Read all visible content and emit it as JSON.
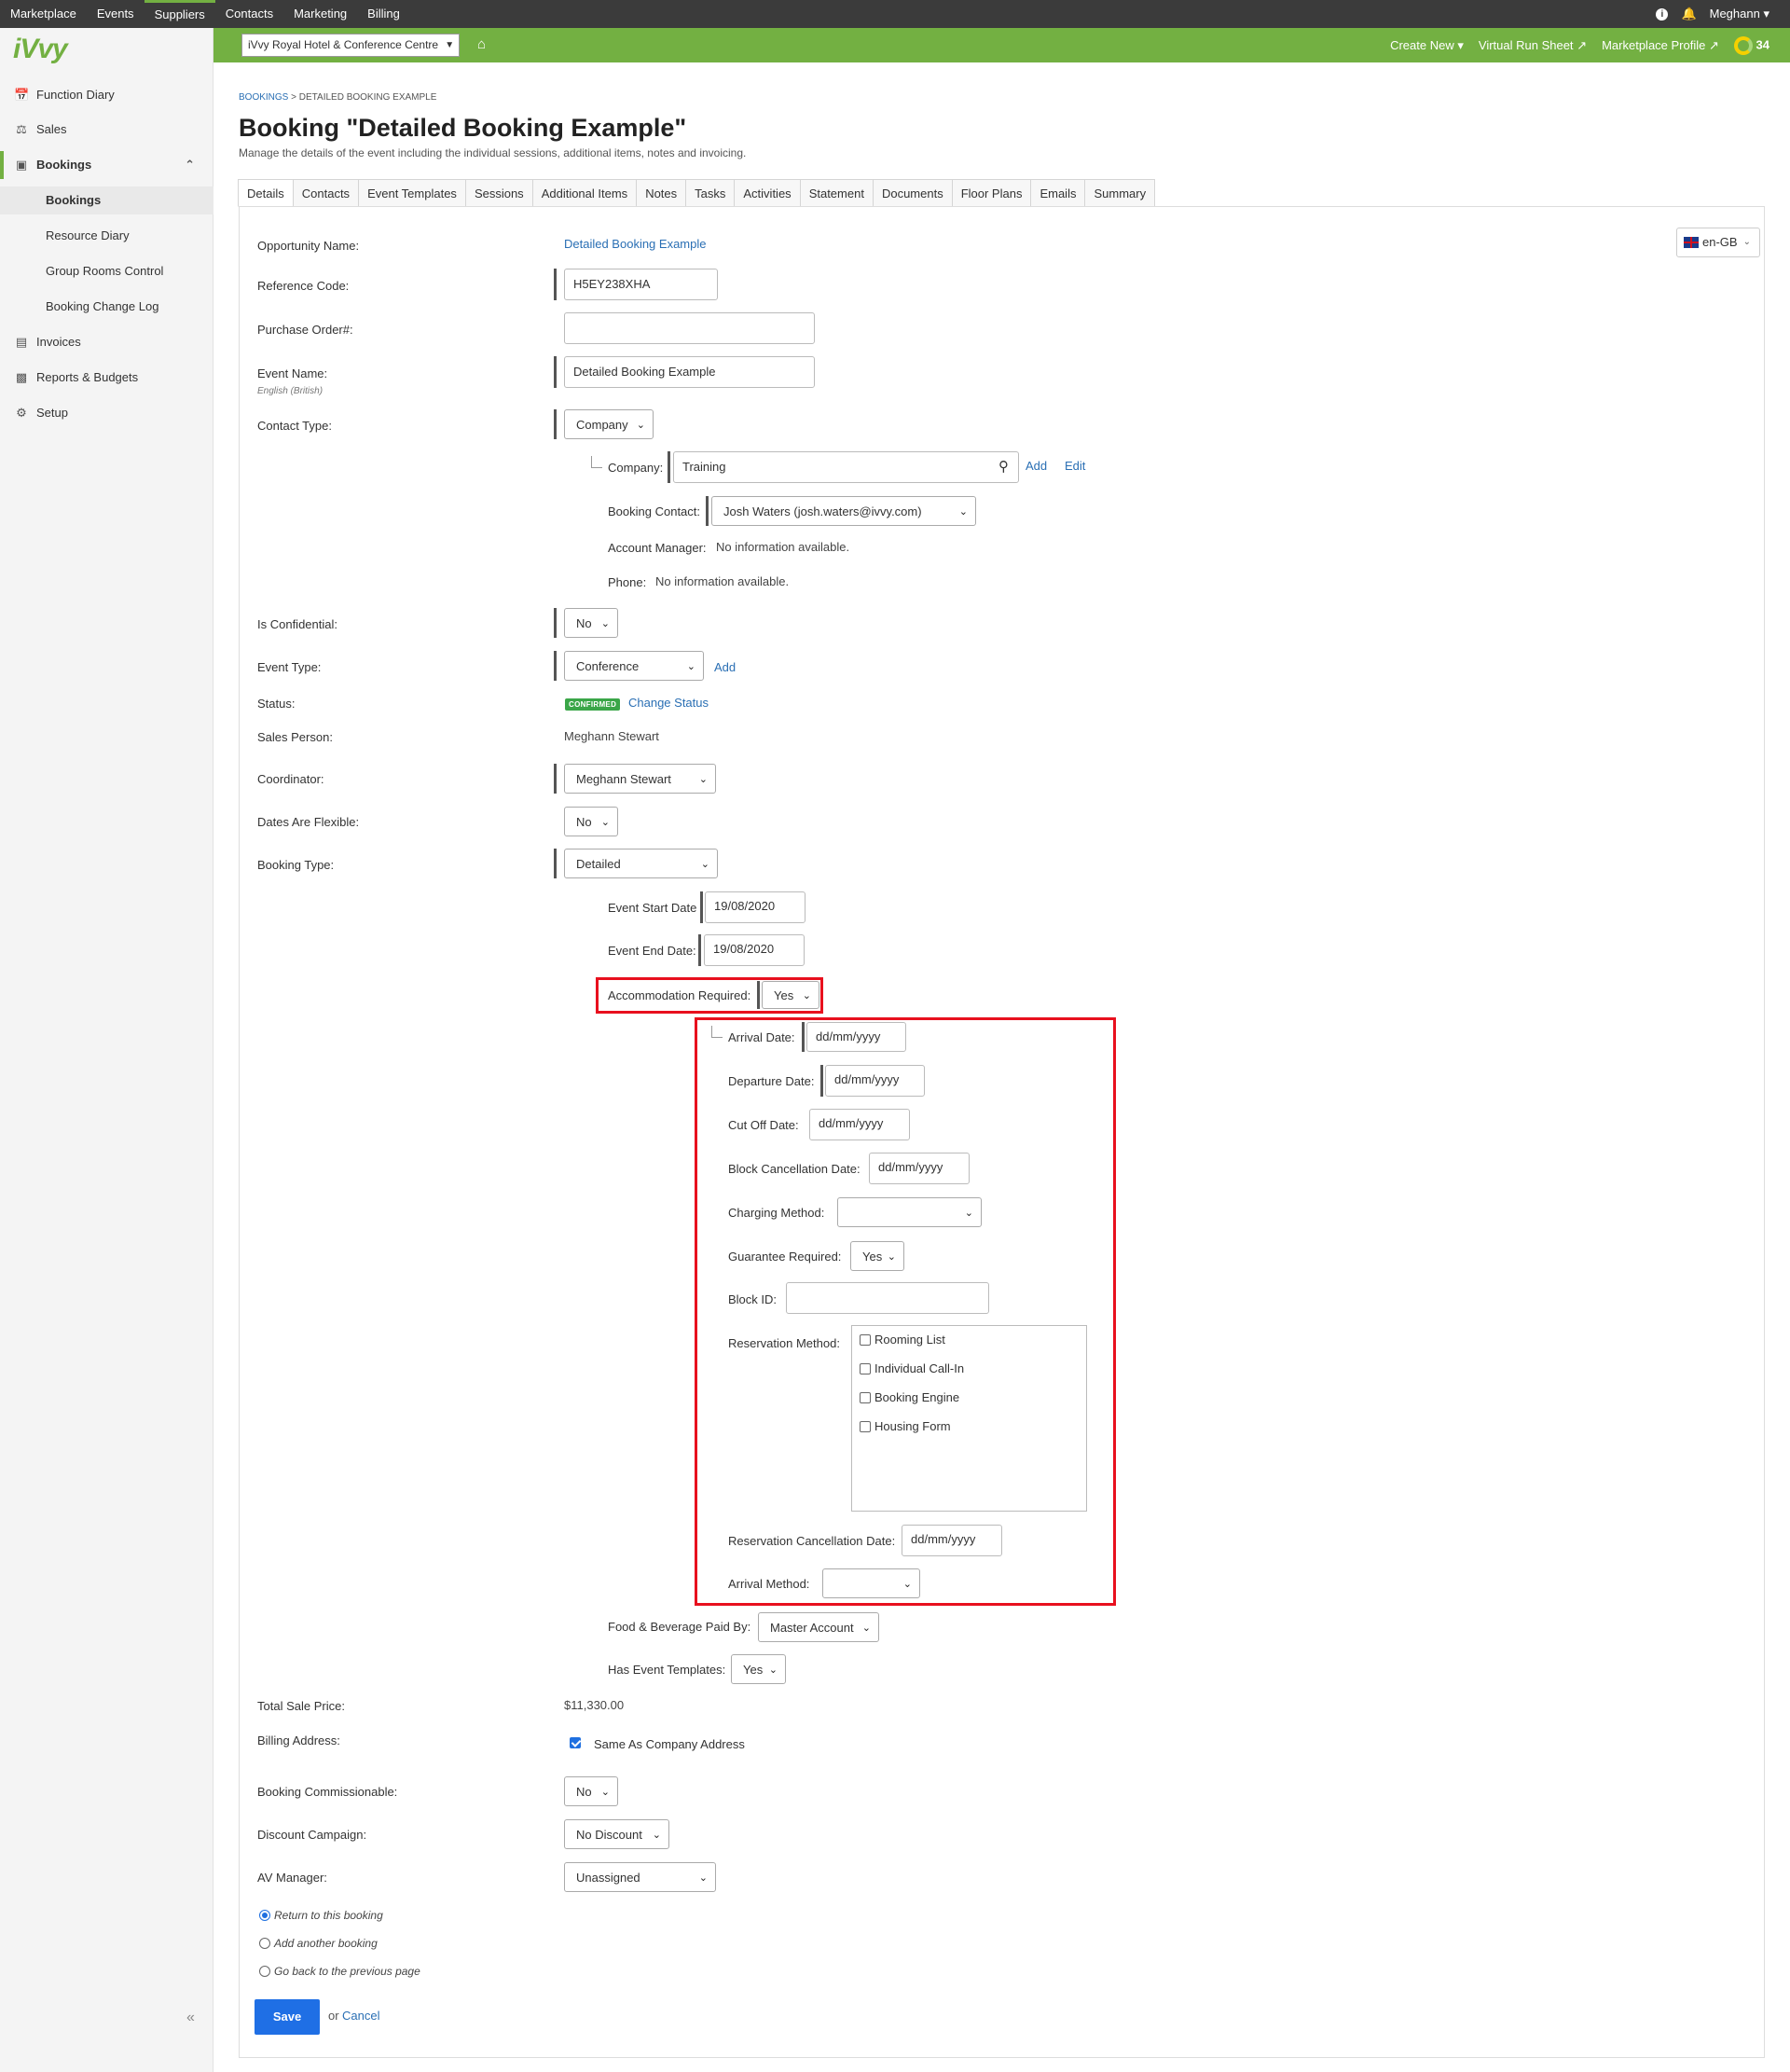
{
  "topnav": [
    "Marketplace",
    "Events",
    "Suppliers",
    "Contacts",
    "Marketing",
    "Billing"
  ],
  "topbar_right": {
    "info_icon": "info-icon",
    "bell_icon": "bell-icon",
    "user": "Meghann"
  },
  "sidebar": {
    "logo": "iVvy",
    "items": [
      "Function Diary",
      "Sales",
      "Bookings"
    ],
    "subitems": [
      "Bookings",
      "Resource Diary",
      "Group Rooms Control",
      "Booking Change Log"
    ],
    "bottom_items": [
      "Invoices",
      "Reports & Budgets",
      "Setup"
    ]
  },
  "greenbar": {
    "venue": "iVvy Royal Hotel & Conference Centre",
    "create_new": "Create New",
    "virtual_run_sheet": "Virtual Run Sheet",
    "marketplace_profile": "Marketplace Profile",
    "score": "34"
  },
  "breadcrumb": {
    "link": "BOOKINGS",
    "sep": " > ",
    "current": "DETAILED BOOKING EXAMPLE"
  },
  "page": {
    "title": "Booking \"Detailed Booking Example\"",
    "subtitle": "Manage the details of the event including the individual sessions, additional items, notes and invoicing."
  },
  "tabs": [
    "Details",
    "Contacts",
    "Event Templates",
    "Sessions",
    "Additional Items",
    "Notes",
    "Tasks",
    "Activities",
    "Statement",
    "Documents",
    "Floor Plans",
    "Emails",
    "Summary"
  ],
  "lang": "en-GB",
  "form": {
    "opportunity_name_label": "Opportunity Name:",
    "opportunity_name_value": "Detailed Booking Example",
    "reference_code_label": "Reference Code:",
    "reference_code_value": "H5EY238XHA",
    "purchase_order_label": "Purchase Order#:",
    "purchase_order_value": "",
    "event_name_label": "Event Name:",
    "event_name_lang": "English (British)",
    "event_name_value": "Detailed Booking Example",
    "contact_type_label": "Contact Type:",
    "contact_type_value": "Company",
    "company_label": "Company:",
    "company_value": "Training",
    "add": "Add",
    "edit": "Edit",
    "booking_contact_label": "Booking Contact:",
    "booking_contact_value": "Josh Waters (josh.waters@ivvy.com)",
    "account_manager_label": "Account Manager:",
    "account_manager_value": "No information available.",
    "phone_label": "Phone:",
    "phone_value": "No information available.",
    "is_confidential_label": "Is Confidential:",
    "is_confidential_value": "No",
    "event_type_label": "Event Type:",
    "event_type_value": "Conference",
    "status_label": "Status:",
    "status_badge": "CONFIRMED",
    "change_status": "Change Status",
    "sales_person_label": "Sales Person:",
    "sales_person_value": "Meghann Stewart",
    "coordinator_label": "Coordinator:",
    "coordinator_value": "Meghann Stewart",
    "dates_flexible_label": "Dates Are Flexible:",
    "dates_flexible_value": "No",
    "booking_type_label": "Booking Type:",
    "booking_type_value": "Detailed",
    "event_start_label": "Event Start Date",
    "event_start_value": "19/08/2020",
    "event_end_label": "Event End Date:",
    "event_end_value": "19/08/2020",
    "accommodation_label": "Accommodation Required:",
    "accommodation_value": "Yes",
    "arrival_date_label": "Arrival Date:",
    "departure_date_label": "Departure Date:",
    "cut_off_label": "Cut Off Date:",
    "block_cancel_label": "Block Cancellation Date:",
    "date_placeholder": "dd/mm/yyyy",
    "charging_method_label": "Charging Method:",
    "charging_method_value": "",
    "guarantee_label": "Guarantee Required:",
    "guarantee_value": "Yes",
    "block_id_label": "Block ID:",
    "block_id_value": "",
    "reservation_method_label": "Reservation Method:",
    "reservation_methods": [
      "Rooming List",
      "Individual Call-In",
      "Booking Engine",
      "Housing Form"
    ],
    "reservation_cancel_label": "Reservation Cancellation Date:",
    "arrival_method_label": "Arrival Method:",
    "arrival_method_value": "",
    "fb_paid_label": "Food & Beverage Paid By:",
    "fb_paid_value": "Master Account",
    "has_templates_label": "Has Event Templates:",
    "has_templates_value": "Yes",
    "total_sale_label": "Total Sale Price:",
    "total_sale_value": "$11,330.00",
    "billing_address_label": "Billing Address:",
    "same_as_company": "Same As Company Address",
    "commissionable_label": "Booking Commissionable:",
    "commissionable_value": "No",
    "discount_label": "Discount Campaign:",
    "discount_value": "No Discount",
    "av_manager_label": "AV Manager:",
    "av_manager_value": "Unassigned"
  },
  "after_save": [
    "Return to this booking",
    "Add another booking",
    "Go back to the previous page"
  ],
  "actions": {
    "save": "Save",
    "or": "or",
    "cancel": "Cancel"
  },
  "colors": {
    "brand_green": "#73b042",
    "topbar": "#3b3b3b",
    "link": "#2a6fb4",
    "save": "#1f6fe5",
    "highlight": "#e8101e"
  }
}
